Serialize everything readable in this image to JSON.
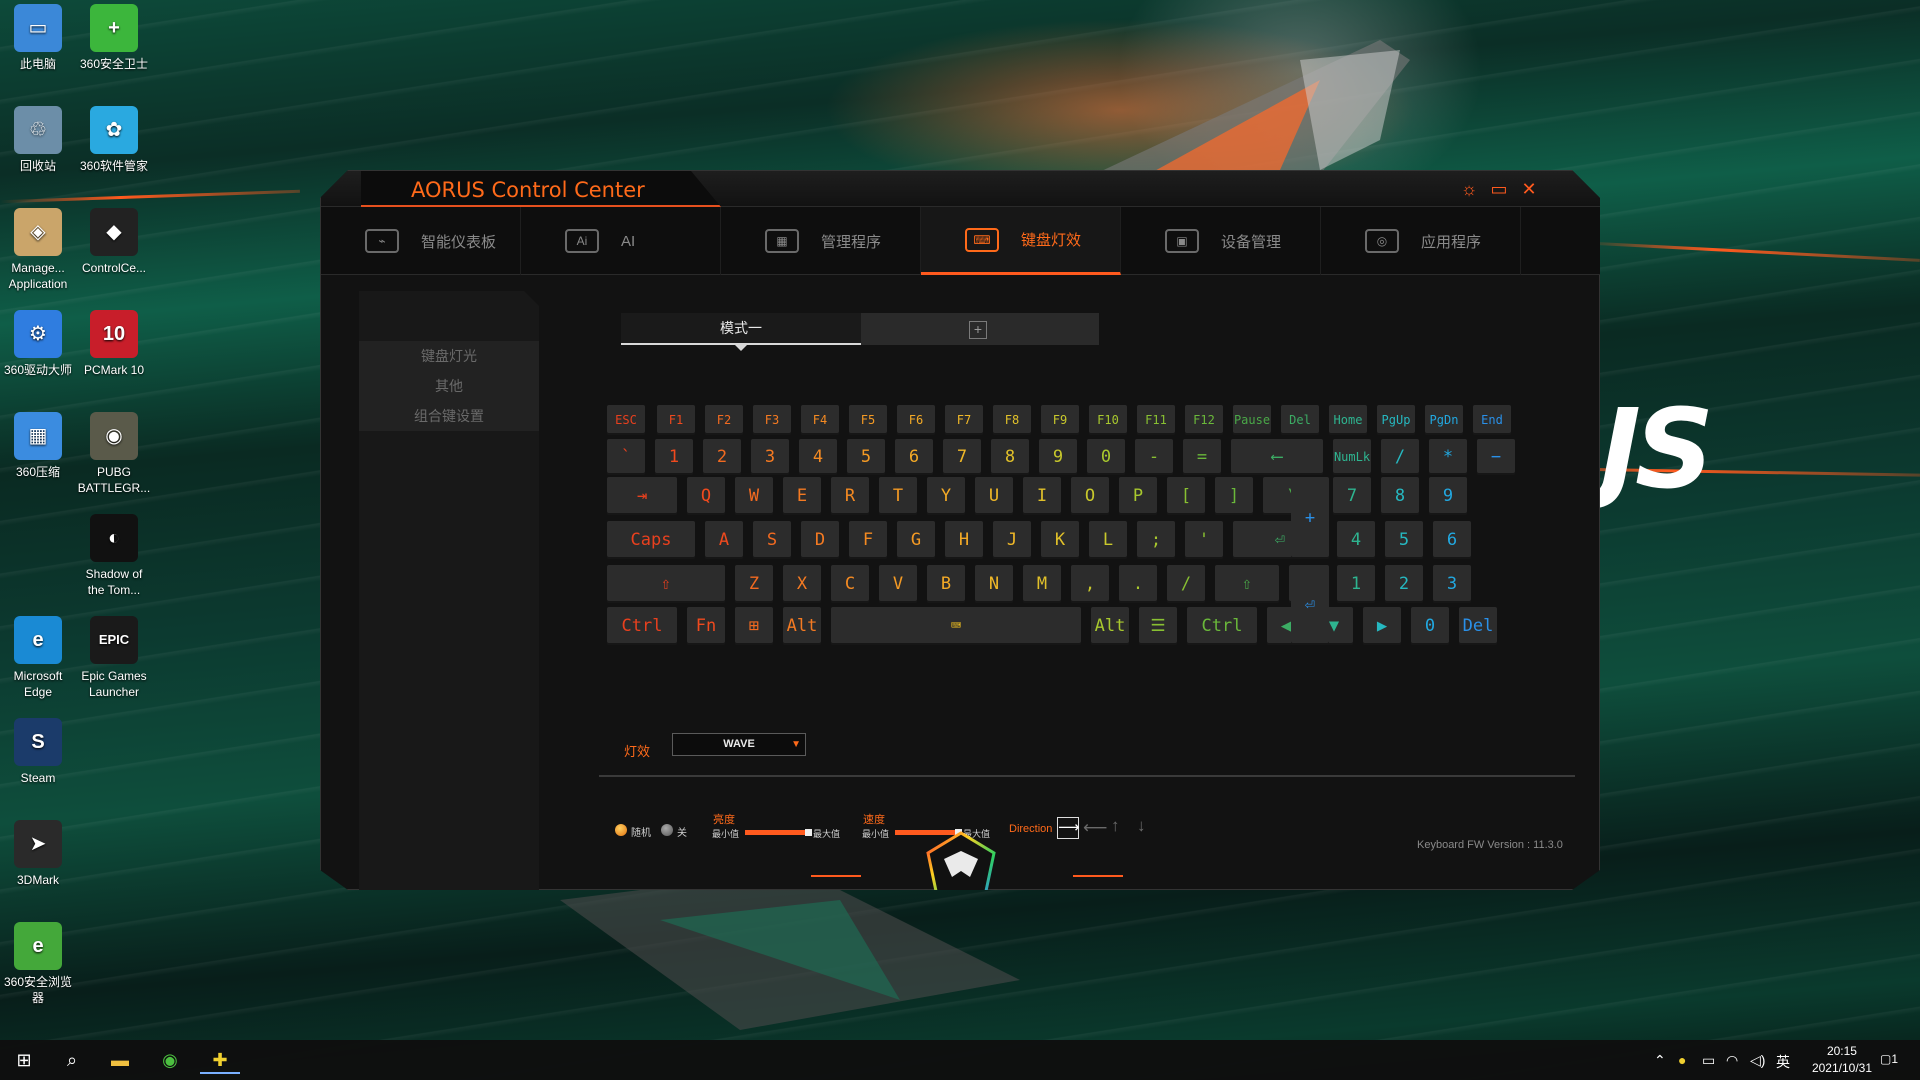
{
  "desktop_icons": [
    {
      "label": "此电脑",
      "icon": "computer-icon",
      "color": "#3b88d8",
      "glyph": "▭"
    },
    {
      "label": "360安全卫士",
      "icon": "360-guard-icon",
      "color": "#3cb63c",
      "glyph": "+"
    },
    {
      "label": "回收站",
      "icon": "recycle-bin-icon",
      "color": "#6c8ea8",
      "glyph": "♲"
    },
    {
      "label": "360软件管家",
      "icon": "360-software-icon",
      "color": "#2aa9e0",
      "glyph": "✿"
    },
    {
      "label": "Manage...\nApplication",
      "icon": "manage-application-icon",
      "color": "#caa56a",
      "glyph": "◈"
    },
    {
      "label": "ControlCe...",
      "icon": "aorus-control-center-icon",
      "color": "#222",
      "glyph": "◆"
    },
    {
      "label": "360驱动大师",
      "icon": "360-driver-icon",
      "color": "#2f7de0",
      "glyph": "⚙"
    },
    {
      "label": "PCMark 10",
      "icon": "pcmark-icon",
      "color": "#c81e2a",
      "glyph": "10"
    },
    {
      "label": "360压缩",
      "icon": "360-zip-icon",
      "color": "#3b8ce0",
      "glyph": "▦"
    },
    {
      "label": "PUBG\nBATTLEGR...",
      "icon": "pubg-icon",
      "color": "#5a5a4a",
      "glyph": "◉"
    },
    {
      "label": "Shadow of\nthe Tom...",
      "icon": "shadow-tomb-raider-icon",
      "color": "#111",
      "glyph": "◐"
    },
    {
      "label": "Microsoft\nEdge",
      "icon": "edge-icon",
      "color": "#1a8ad4",
      "glyph": "e"
    },
    {
      "label": "Epic Games\nLauncher",
      "icon": "epic-games-icon",
      "color": "#1a1a1a",
      "glyph": "EPIC"
    },
    {
      "label": "Steam",
      "icon": "steam-icon",
      "color": "#1b3b6a",
      "glyph": "S"
    },
    {
      "label": "3DMark",
      "icon": "3dmark-icon",
      "color": "#2a2a2a",
      "glyph": "➤"
    },
    {
      "label": "360安全浏览\n器",
      "icon": "360-browser-icon",
      "color": "#44a83a",
      "glyph": "e"
    }
  ],
  "window": {
    "title": "AORUS Control Center",
    "settings_glyph": "☼",
    "maximize_glyph": "▭",
    "close_glyph": "✕"
  },
  "nav_tabs": [
    {
      "label": "智能仪表板",
      "icon_glyph": "⌁",
      "active": false
    },
    {
      "label": "AI",
      "icon_glyph": "Ai",
      "active": false
    },
    {
      "label": "管理程序",
      "icon_glyph": "▦",
      "active": false
    },
    {
      "label": "键盘灯效",
      "icon_glyph": "⌨",
      "active": true
    },
    {
      "label": "设备管理",
      "icon_glyph": "▣",
      "active": false
    },
    {
      "label": "应用程序",
      "icon_glyph": "◎",
      "active": false
    }
  ],
  "sidebar": [
    {
      "label": "键盘灯光",
      "active": true
    },
    {
      "label": "其他",
      "active": false
    },
    {
      "label": "组合键设置",
      "active": false
    }
  ],
  "mode": {
    "tab_label": "模式一",
    "add_glyph": "+"
  },
  "keyboard_rows": [
    [
      {
        "t": "ESC",
        "c": "#e8401e",
        "w": 38,
        "s": 1
      },
      {
        "t": "F1",
        "c": "#f04a1e",
        "w": 38,
        "s": 1
      },
      {
        "t": "F2",
        "c": "#f26a20",
        "w": 38,
        "s": 1
      },
      {
        "t": "F3",
        "c": "#f47a22",
        "w": 38,
        "s": 1
      },
      {
        "t": "F4",
        "c": "#f48a22",
        "w": 38,
        "s": 1
      },
      {
        "t": "F5",
        "c": "#f49a24",
        "w": 38,
        "s": 1
      },
      {
        "t": "F6",
        "c": "#f4aa26",
        "w": 38,
        "s": 1
      },
      {
        "t": "F7",
        "c": "#f0b828",
        "w": 38,
        "s": 1
      },
      {
        "t": "F8",
        "c": "#e0c02a",
        "w": 38,
        "s": 1
      },
      {
        "t": "F9",
        "c": "#c8c82c",
        "w": 38,
        "s": 1
      },
      {
        "t": "F10",
        "c": "#a8c82e",
        "w": 38,
        "s": 1
      },
      {
        "t": "F11",
        "c": "#88c032",
        "w": 38,
        "s": 1
      },
      {
        "t": "F12",
        "c": "#6ab83a",
        "w": 38,
        "s": 1
      },
      {
        "t": "Pause",
        "c": "#4aa848",
        "w": 38,
        "s": 1
      },
      {
        "t": "Del",
        "c": "#3cac64",
        "w": 38,
        "s": 1
      },
      {
        "t": "Home",
        "c": "#2eb490",
        "w": 38,
        "s": 1
      },
      {
        "t": "PgUp",
        "c": "#26b8c0",
        "w": 38,
        "s": 1
      },
      {
        "t": "PgDn",
        "c": "#22a8e0",
        "w": 38,
        "s": 1
      },
      {
        "t": "End",
        "c": "#2a90e8",
        "w": 38,
        "s": 1
      }
    ],
    [
      {
        "t": "`",
        "c": "#e8401e",
        "w": 38
      },
      {
        "t": "1",
        "c": "#f04a1e",
        "w": 38
      },
      {
        "t": "2",
        "c": "#f26a20",
        "w": 38
      },
      {
        "t": "3",
        "c": "#f47a22",
        "w": 38
      },
      {
        "t": "4",
        "c": "#f48a22",
        "w": 38
      },
      {
        "t": "5",
        "c": "#f49a24",
        "w": 38
      },
      {
        "t": "6",
        "c": "#f4aa26",
        "w": 38
      },
      {
        "t": "7",
        "c": "#f0b828",
        "w": 38
      },
      {
        "t": "8",
        "c": "#e0c02a",
        "w": 38
      },
      {
        "t": "9",
        "c": "#c8c82c",
        "w": 38
      },
      {
        "t": "0",
        "c": "#a8c82e",
        "w": 38
      },
      {
        "t": "-",
        "c": "#88c032",
        "w": 38
      },
      {
        "t": "=",
        "c": "#6ab83a",
        "w": 38
      },
      {
        "t": "⟵",
        "c": "#3cac64",
        "w": 92
      },
      {
        "t": "NumLk",
        "c": "#2eb490",
        "w": 38,
        "s": 1
      },
      {
        "t": "/",
        "c": "#26b8c0",
        "w": 38
      },
      {
        "t": "*",
        "c": "#22a8e0",
        "w": 38
      },
      {
        "t": "−",
        "c": "#2a90e8",
        "w": 38
      }
    ],
    [
      {
        "t": "⇥",
        "c": "#e8401e",
        "w": 70
      },
      {
        "t": "Q",
        "c": "#f04a1e",
        "w": 38
      },
      {
        "t": "W",
        "c": "#f26a20",
        "w": 38
      },
      {
        "t": "E",
        "c": "#f47a22",
        "w": 38
      },
      {
        "t": "R",
        "c": "#f48a22",
        "w": 38
      },
      {
        "t": "T",
        "c": "#f49a24",
        "w": 38
      },
      {
        "t": "Y",
        "c": "#f4aa26",
        "w": 38
      },
      {
        "t": "U",
        "c": "#f0b828",
        "w": 38
      },
      {
        "t": "I",
        "c": "#e0c02a",
        "w": 38
      },
      {
        "t": "O",
        "c": "#c8c82c",
        "w": 38
      },
      {
        "t": "P",
        "c": "#a8c82e",
        "w": 38
      },
      {
        "t": "[",
        "c": "#88c032",
        "w": 38
      },
      {
        "t": "]",
        "c": "#6ab83a",
        "w": 38
      },
      {
        "t": "\\",
        "c": "#4aa848",
        "w": 60
      },
      {
        "t": "7",
        "c": "#2eb490",
        "w": 38
      },
      {
        "t": "8",
        "c": "#26b8c0",
        "w": 38
      },
      {
        "t": "9",
        "c": "#22a8e0",
        "w": 38
      }
    ],
    [
      {
        "t": "Caps",
        "c": "#e8401e",
        "w": 88
      },
      {
        "t": "A",
        "c": "#f04a1e",
        "w": 38
      },
      {
        "t": "S",
        "c": "#f26a20",
        "w": 38
      },
      {
        "t": "D",
        "c": "#f47a22",
        "w": 38
      },
      {
        "t": "F",
        "c": "#f48a22",
        "w": 38
      },
      {
        "t": "G",
        "c": "#f49a24",
        "w": 38
      },
      {
        "t": "H",
        "c": "#f4aa26",
        "w": 38
      },
      {
        "t": "J",
        "c": "#f0b828",
        "w": 38
      },
      {
        "t": "K",
        "c": "#e0c02a",
        "w": 38
      },
      {
        "t": "L",
        "c": "#c8c82c",
        "w": 38
      },
      {
        "t": ";",
        "c": "#a8c82e",
        "w": 38
      },
      {
        "t": "'",
        "c": "#88c032",
        "w": 38
      },
      {
        "t": "⏎",
        "c": "#3cac64",
        "w": 94
      },
      {
        "t": "4",
        "c": "#2eb490",
        "w": 38
      },
      {
        "t": "5",
        "c": "#26b8c0",
        "w": 38
      },
      {
        "t": "6",
        "c": "#22a8e0",
        "w": 38
      }
    ],
    [
      {
        "t": "⇧",
        "c": "#e8401e",
        "w": 118
      },
      {
        "t": "Z",
        "c": "#f26a20",
        "w": 38
      },
      {
        "t": "X",
        "c": "#f47a22",
        "w": 38
      },
      {
        "t": "C",
        "c": "#f48a22",
        "w": 38
      },
      {
        "t": "V",
        "c": "#f49a24",
        "w": 38
      },
      {
        "t": "B",
        "c": "#f4aa26",
        "w": 38
      },
      {
        "t": "N",
        "c": "#f0b828",
        "w": 38
      },
      {
        "t": "M",
        "c": "#e0c02a",
        "w": 38
      },
      {
        "t": ",",
        "c": "#c8c82c",
        "w": 38
      },
      {
        "t": ".",
        "c": "#a8c82e",
        "w": 38
      },
      {
        "t": "/",
        "c": "#88c032",
        "w": 38
      },
      {
        "t": "⇧",
        "c": "#4aa848",
        "w": 64
      },
      {
        "t": "▲",
        "c": "#3cb874",
        "w": 38
      },
      {
        "t": "1",
        "c": "#2eb490",
        "w": 38
      },
      {
        "t": "2",
        "c": "#26b8c0",
        "w": 38
      },
      {
        "t": "3",
        "c": "#22a8e0",
        "w": 38
      }
    ],
    [
      {
        "t": "Ctrl",
        "c": "#e8401e",
        "w": 70
      },
      {
        "t": "Fn",
        "c": "#f04a1e",
        "w": 38
      },
      {
        "t": "⊞",
        "c": "#f26a20",
        "w": 38
      },
      {
        "t": "Alt",
        "c": "#f47a22",
        "w": 38
      },
      {
        "t": "⌨",
        "c": "#f0c020",
        "w": 250
      },
      {
        "t": "Alt",
        "c": "#a8c82e",
        "w": 38
      },
      {
        "t": "☰",
        "c": "#88c032",
        "w": 38
      },
      {
        "t": "Ctrl",
        "c": "#6ab83a",
        "w": 70
      },
      {
        "t": "◀",
        "c": "#3cac64",
        "w": 38
      },
      {
        "t": "▼",
        "c": "#2eb490",
        "w": 38
      },
      {
        "t": "▶",
        "c": "#26b8c0",
        "w": 38
      },
      {
        "t": "0",
        "c": "#22a8e0",
        "w": 38
      },
      {
        "t": "Del",
        "c": "#2a90e8",
        "w": 38
      }
    ]
  ],
  "numpad_tall": [
    {
      "t": "+",
      "c": "#2a90e8"
    },
    {
      "t": "⏎",
      "c": "#2a90e8"
    }
  ],
  "effect": {
    "label": "灯效",
    "value": "WAVE",
    "arrow": "▼"
  },
  "controls": {
    "random_label": "随机",
    "off_label": "关",
    "brightness_label": "亮度",
    "speed_label": "速度",
    "min_label": "最小值",
    "max_label": "最大值",
    "direction_label": "Direction",
    "brightness_level": 1.0,
    "speed_level": 1.0
  },
  "fw_version": "Keyboard FW Version : 11.3.0",
  "taskbar": {
    "time": "20:15",
    "date": "2021/10/31",
    "ime": "英",
    "notification_count": "1"
  },
  "brand_text": "JS"
}
